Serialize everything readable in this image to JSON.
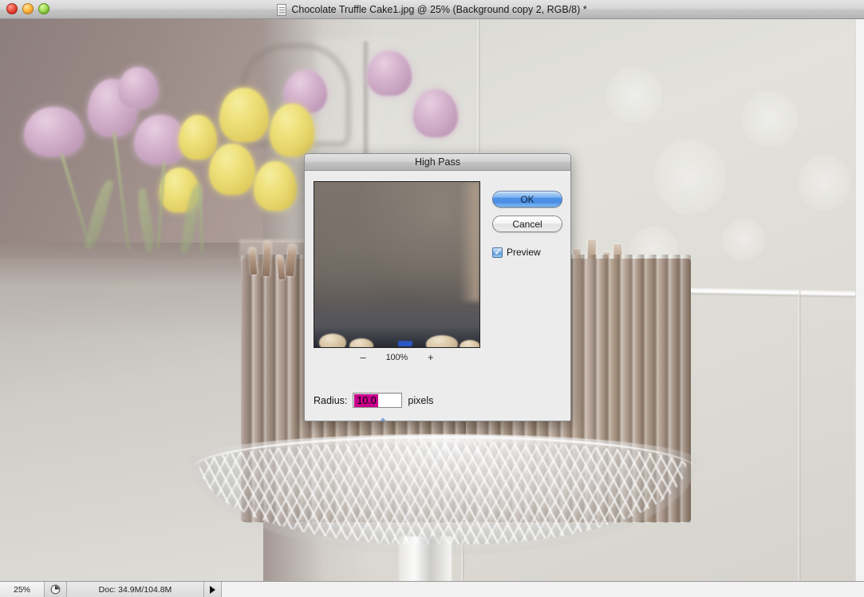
{
  "window": {
    "title": "Chocolate Truffle Cake1.jpg @ 25% (Background copy 2, RGB/8) *",
    "doc_icon": "document-icon",
    "controls": {
      "close": "close-button",
      "minimize": "minimize-button",
      "zoom": "zoom-button"
    }
  },
  "status_bar": {
    "zoom_level": "25%",
    "clock_icon": "clock-icon",
    "doc_size": "Doc: 34.9M/104.8M",
    "expand_arrow": "▶"
  },
  "dialog": {
    "title": "High Pass",
    "buttons": {
      "ok": "OK",
      "cancel": "Cancel"
    },
    "preview_checkbox": {
      "label": "Preview",
      "checked": true,
      "check_glyph": "✓"
    },
    "preview_zoom": {
      "minus": "–",
      "value": "100%",
      "plus": "+"
    },
    "radius": {
      "label": "Radius:",
      "value": "10.0",
      "units": "pixels",
      "selected": true,
      "selection_color": "#c8008c",
      "slider_percent": 40
    }
  },
  "colors": {
    "dialog_body": "#ececec",
    "ok_accent": "#4f93e6",
    "selection_magenta": "#c8008c",
    "titlebar_top": "#e2e2e2"
  },
  "image": {
    "subject": "chocolate-truffle-cake-photo"
  }
}
